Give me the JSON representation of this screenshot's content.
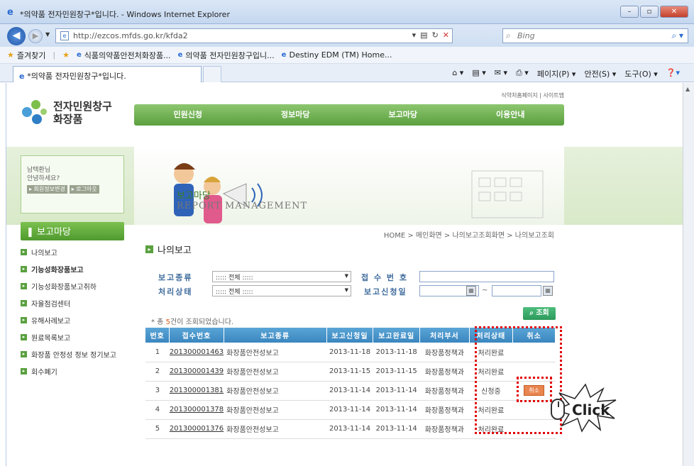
{
  "browser": {
    "window_title": "*의약품 전자민원창구*입니다. - Windows Internet Explorer",
    "url": "http://ezcos.mfds.go.kr/kfda2",
    "search_placeholder": "Bing",
    "favorites_label": "즐겨찾기",
    "favorites": [
      "식품의약품안전처화장품...",
      "의약품 전자민원창구입니...",
      "Destiny EDM (TM) Home..."
    ],
    "tab_title": "*의약품 전자민원창구*입니다.",
    "tools": {
      "page": "페이지(P) ▾",
      "safety": "안전(S) ▾",
      "tools": "도구(O) ▾"
    }
  },
  "site": {
    "brand_line1": "전자민원창구",
    "brand_line2": "화장품",
    "top_links": "식약처홈페이지  |  사이트맵",
    "gnb": [
      "민원신청",
      "정보마당",
      "보고마당",
      "이용안내"
    ],
    "hero_title": "보고마당",
    "hero_sub": "REPORT MANAGEMENT",
    "user": {
      "name": "남택환님",
      "greeting": "안녕하세요?",
      "btn_edit": "▸ 회원정보변경",
      "btn_logout": "▸ 로그아웃"
    },
    "lnb_title": "보고마당",
    "lnb_items": [
      "나의보고",
      "기능성화장품보고",
      "기능성화장품보고취하",
      "자율점검센터",
      "유해사례보고",
      "원료목록보고",
      "화장품 안정성 정보 정기보고",
      "회수폐기"
    ]
  },
  "content": {
    "breadcrumb": "HOME > 메인화면 > 나의보고조회화면 > 나의보고조회",
    "title": "나의보고",
    "filter": {
      "report_type_label": "보고종류",
      "report_type_value": "::::: 전체 :::::",
      "status_label": "처리상태",
      "status_value": "::::: 전체 :::::",
      "receipt_label": "접 수 번 호",
      "date_label": "보고신청일",
      "tilde": "~"
    },
    "count_prefix": "* 총 ",
    "count_value": "5",
    "count_suffix": "건이 조회되었습니다.",
    "search_button": "조회",
    "table": {
      "headers": [
        "번호",
        "접수번호",
        "보고종류",
        "보고신청일",
        "보고완료일",
        "처리부서",
        "처리상태",
        "취소"
      ],
      "rows": [
        {
          "no": "1",
          "receipt": "201300001463",
          "type": "화장품안전성보고",
          "apply": "2013-11-18",
          "done": "2013-11-18",
          "dept": "화장품정책과",
          "status": "처리완료",
          "cancel": ""
        },
        {
          "no": "2",
          "receipt": "201300001439",
          "type": "화장품안전성보고",
          "apply": "2013-11-15",
          "done": "2013-11-15",
          "dept": "화장품정책과",
          "status": "처리완료",
          "cancel": ""
        },
        {
          "no": "3",
          "receipt": "201300001381",
          "type": "화장품안전성보고",
          "apply": "2013-11-14",
          "done": "2013-11-14",
          "dept": "화장품정책과",
          "status": "신청중",
          "cancel": "취소"
        },
        {
          "no": "4",
          "receipt": "201300001378",
          "type": "화장품안전성보고",
          "apply": "2013-11-14",
          "done": "2013-11-14",
          "dept": "화장품정책과",
          "status": "처리완료",
          "cancel": ""
        },
        {
          "no": "5",
          "receipt": "201300001376",
          "type": "화장품안전성보고",
          "apply": "2013-11-14",
          "done": "2013-11-14",
          "dept": "화장품정책과",
          "status": "처리완료",
          "cancel": ""
        }
      ]
    }
  },
  "annotation": {
    "click_label": "Click"
  },
  "colors": {
    "accent_green": "#5aa03f",
    "table_header_blue": "#3a86bf",
    "highlight_red": "#e10000",
    "cancel_orange": "#e9854f"
  }
}
